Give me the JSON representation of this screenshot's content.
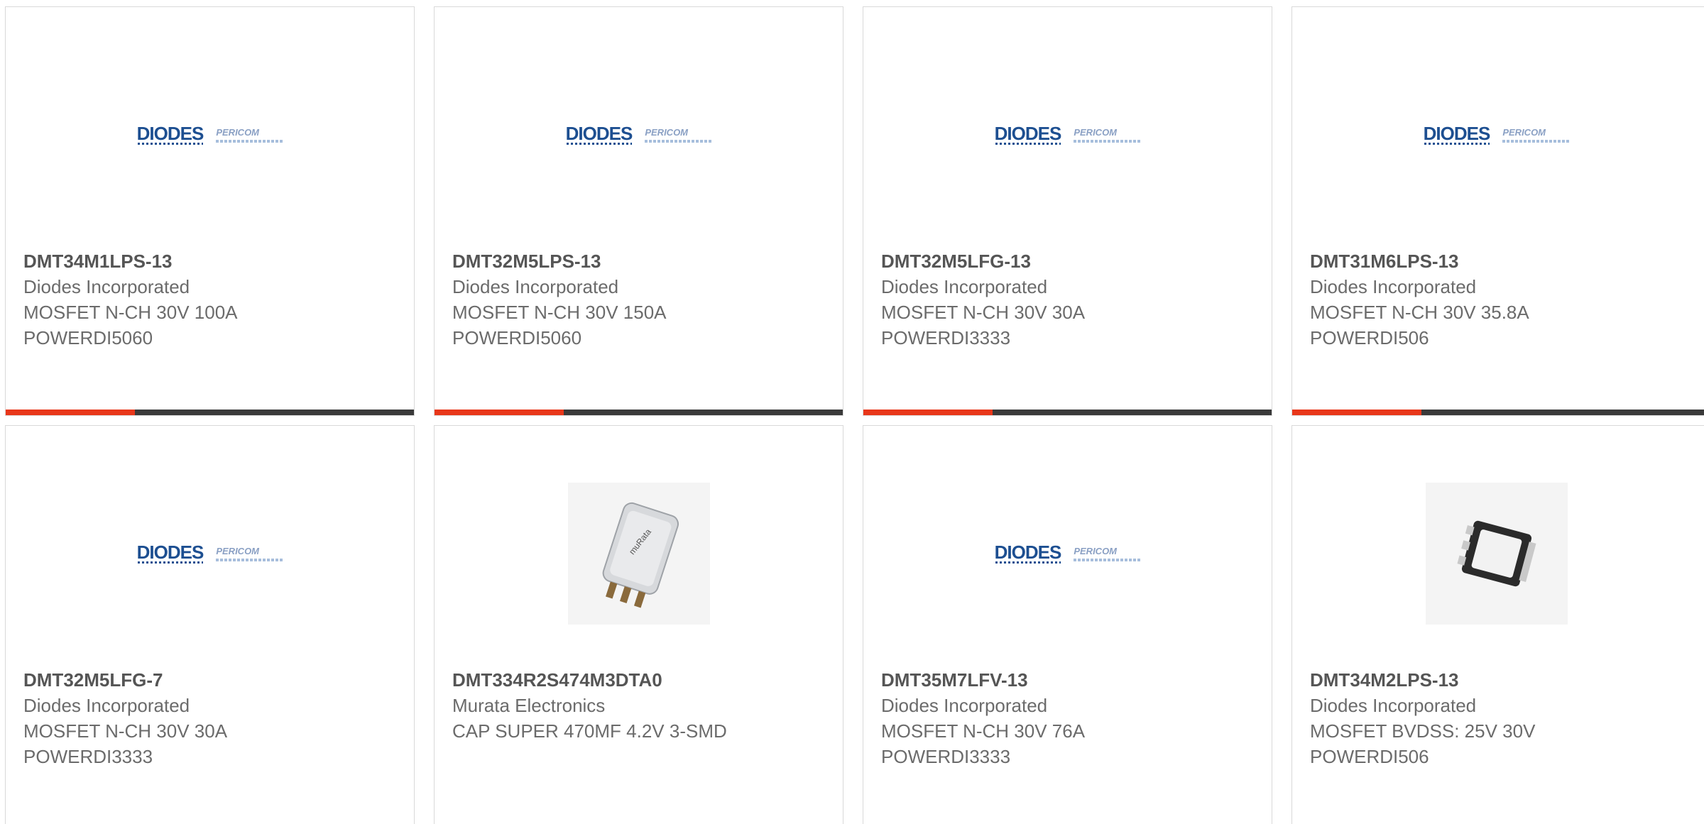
{
  "logo_text": {
    "diodes": "DIODES",
    "pericom": "PERICOM"
  },
  "colors": {
    "accent_bar": "#e8371a",
    "dark_bar": "#3a3a3a",
    "diodes_blue": "#1d4f91"
  },
  "products": [
    {
      "part": "DMT34M1LPS-13",
      "manufacturer": "Diodes Incorporated",
      "description_line1": "MOSFET N-CH 30V 100A",
      "description_line2": "POWERDI5060",
      "image": "diodes-logo"
    },
    {
      "part": "DMT32M5LPS-13",
      "manufacturer": "Diodes Incorporated",
      "description_line1": "MOSFET N-CH 30V 150A",
      "description_line2": "POWERDI5060",
      "image": "diodes-logo"
    },
    {
      "part": "DMT32M5LFG-13",
      "manufacturer": "Diodes Incorporated",
      "description_line1": "MOSFET N-CH 30V 30A",
      "description_line2": "POWERDI3333",
      "image": "diodes-logo"
    },
    {
      "part": "DMT31M6LPS-13",
      "manufacturer": "Diodes Incorporated",
      "description_line1": "MOSFET N-CH 30V 35.8A",
      "description_line2": "POWERDI506",
      "image": "diodes-logo"
    },
    {
      "part": "DMT32M5LFG-7",
      "manufacturer": "Diodes Incorporated",
      "description_line1": "MOSFET N-CH 30V 30A",
      "description_line2": "POWERDI3333",
      "image": "diodes-logo"
    },
    {
      "part": "DMT334R2S474M3DTA0",
      "manufacturer": "Murata Electronics",
      "description_line1": "CAP SUPER 470MF 4.2V 3-SMD",
      "description_line2": "",
      "image": "supercap-photo"
    },
    {
      "part": "DMT35M7LFV-13",
      "manufacturer": "Diodes Incorporated",
      "description_line1": "MOSFET N-CH 30V 76A",
      "description_line2": "POWERDI3333",
      "image": "diodes-logo"
    },
    {
      "part": "DMT34M2LPS-13",
      "manufacturer": "Diodes Incorporated",
      "description_line1": "MOSFET BVDSS: 25V 30V",
      "description_line2": "POWERDI506",
      "image": "mosfet-package-photo"
    }
  ]
}
